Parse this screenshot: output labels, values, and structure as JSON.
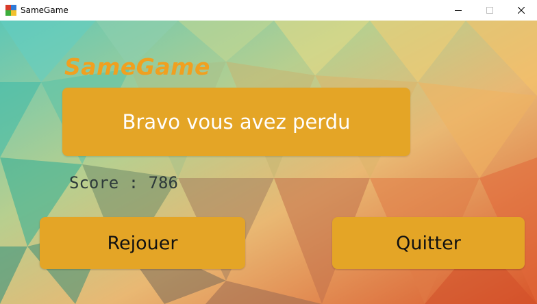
{
  "window": {
    "title": "SameGame",
    "icon": "samegame-app-icon",
    "controls": [
      "minimize-icon",
      "maximize-icon",
      "close-icon"
    ]
  },
  "game": {
    "logo_text": "SameGame",
    "message": "Bravo vous avez perdu",
    "score_label": "Score : 786",
    "score_value": 786,
    "replay_label": "Rejouer",
    "quit_label": "Quitter"
  },
  "colors": {
    "accent": "#e4a526",
    "logo": "#f0a020",
    "score_text": "#2e3a3a",
    "button_text": "#111111"
  }
}
